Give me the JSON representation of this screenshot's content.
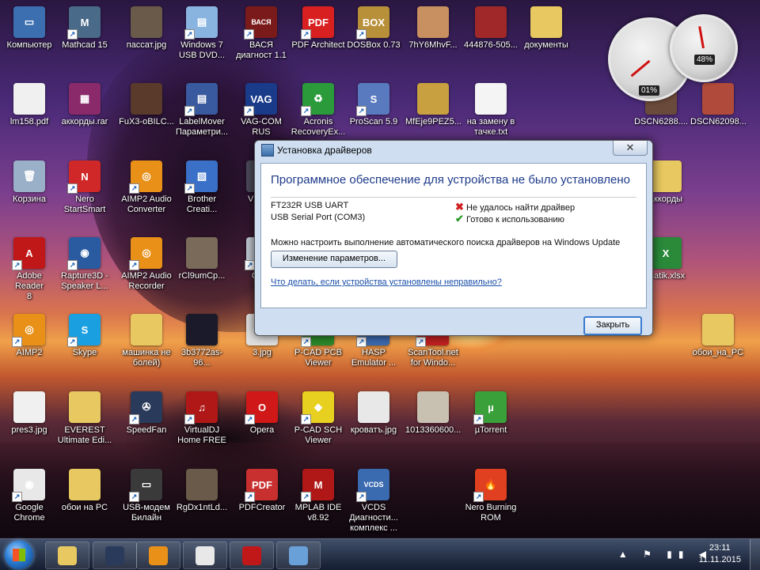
{
  "desktop_icons": [
    {
      "label": "Компьютер",
      "color": "#3b6fb0",
      "sym": "▭",
      "shortcut": false
    },
    {
      "label": "Mathcad 15",
      "color": "#4a6a8a",
      "sym": "M",
      "shortcut": true
    },
    {
      "label": "пассат.jpg",
      "color": "#6a5a4a",
      "sym": "",
      "shortcut": false
    },
    {
      "label": "Windows 7\nUSB DVD...",
      "color": "#8ab4e0",
      "sym": "▤",
      "shortcut": true
    },
    {
      "label": "ВАСЯ\nдиагност 1.1",
      "color": "#7a1a1a",
      "sym": "ВАСЯ",
      "shortcut": true
    },
    {
      "label": "PDF Architect",
      "color": "#d82020",
      "sym": "PDF",
      "shortcut": true
    },
    {
      "label": "DOSBox 0.73",
      "color": "#b8903a",
      "sym": "BOX",
      "shortcut": true
    },
    {
      "label": "7hY6MhvF...",
      "color": "#c89060",
      "sym": "",
      "shortcut": false
    },
    {
      "label": "444876-505...",
      "color": "#a02828",
      "sym": "",
      "shortcut": false
    },
    {
      "label": "документы",
      "color": "#e8c860",
      "sym": "",
      "shortcut": false
    },
    {
      "label": "lm158.pdf",
      "color": "#f0f0f0",
      "sym": "",
      "shortcut": false
    },
    {
      "label": "аккорды.rar",
      "color": "#8a2a6a",
      "sym": "▦",
      "shortcut": false
    },
    {
      "label": "FuX3-oBILC...",
      "color": "#5a3a2a",
      "sym": "",
      "shortcut": false
    },
    {
      "label": "LabelMover\nПараметри...",
      "color": "#3a5aa0",
      "sym": "▤",
      "shortcut": true
    },
    {
      "label": "VAG-COM\nRUS",
      "color": "#1a3a8a",
      "sym": "VAG",
      "shortcut": true
    },
    {
      "label": "Acronis\nRecoveryEx...",
      "color": "#2a9a3a",
      "sym": "♻",
      "shortcut": true
    },
    {
      "label": "ProScan 5.9",
      "color": "#5a7ac0",
      "sym": "S",
      "shortcut": true
    },
    {
      "label": "MfEje9PEZ5...",
      "color": "#c8a040",
      "sym": "",
      "shortcut": false
    },
    {
      "label": "на замену в\nтачке.txt",
      "color": "#f4f4f4",
      "sym": "",
      "shortcut": false
    },
    {
      "label": "DSCN6288....",
      "color": "#6a4a3a",
      "sym": "",
      "shortcut": false
    },
    {
      "label": "DSCN62098...",
      "color": "#b04a3a",
      "sym": "",
      "shortcut": false
    },
    {
      "label": "Корзина",
      "color": "#9ab0c8",
      "sym": "🗑",
      "shortcut": false
    },
    {
      "label": "Nero\nStartSmart",
      "color": "#d02828",
      "sym": "N",
      "shortcut": true
    },
    {
      "label": "AIMP2 Audio\nConverter",
      "color": "#e89018",
      "sym": "◎",
      "shortcut": true
    },
    {
      "label": "Brother\nCreati...",
      "color": "#3a70c8",
      "sym": "▧",
      "shortcut": true
    },
    {
      "label": "VzfsJ...",
      "color": "#4a4a5a",
      "sym": "",
      "shortcut": false
    },
    {
      "label": "аккорды",
      "color": "#e8c860",
      "sym": "",
      "shortcut": false
    },
    {
      "label": "Adobe Reader\n8",
      "color": "#c01818",
      "sym": "A",
      "shortcut": true
    },
    {
      "label": "Rapture3D -\nSpeaker L...",
      "color": "#2a5aa0",
      "sym": "◉",
      "shortcut": true
    },
    {
      "label": "AIMP2 Audio\nRecorder",
      "color": "#e89018",
      "sym": "◎",
      "shortcut": true
    },
    {
      "label": "rCl9umCp...",
      "color": "#7a6a5a",
      "sym": "",
      "shortcut": false
    },
    {
      "label": "Car...\nOl...",
      "color": "#c0c8d0",
      "sym": "",
      "shortcut": true
    },
    {
      "label": "matik.xlsx",
      "color": "#2a8a3a",
      "sym": "X",
      "shortcut": false
    },
    {
      "label": "AIMP2",
      "color": "#e89018",
      "sym": "◎",
      "shortcut": true
    },
    {
      "label": "Skype",
      "color": "#1aa0e0",
      "sym": "S",
      "shortcut": true
    },
    {
      "label": "машинка не\nболей)",
      "color": "#e8c860",
      "sym": "",
      "shortcut": false
    },
    {
      "label": "3b3772as-96...",
      "color": "#1a1a2a",
      "sym": "",
      "shortcut": false
    },
    {
      "label": "3.jpg",
      "color": "#e0e0e0",
      "sym": "",
      "shortcut": false
    },
    {
      "label": "P-CAD PCB\nViewer",
      "color": "#2a8a2a",
      "sym": "◆",
      "shortcut": true
    },
    {
      "label": "HASP\nEmulator ...",
      "color": "#3a6ab0",
      "sym": "EMUL",
      "shortcut": true
    },
    {
      "label": "ScanTool.net\nfor Windo...",
      "color": "#c02020",
      "sym": ".net",
      "shortcut": true
    },
    {
      "label": "обои_на_PC",
      "color": "#e8c860",
      "sym": "",
      "shortcut": false
    },
    {
      "label": "pres3.jpg",
      "color": "#f0f0f0",
      "sym": "",
      "shortcut": false
    },
    {
      "label": "EVEREST\nUltimate Edi...",
      "color": "#e8c860",
      "sym": "",
      "shortcut": false
    },
    {
      "label": "SpeedFan",
      "color": "#2a3a5a",
      "sym": "✇",
      "shortcut": true
    },
    {
      "label": "VirtualDJ\nHome FREE",
      "color": "#b01818",
      "sym": "♫",
      "shortcut": true
    },
    {
      "label": "Opera",
      "color": "#d01818",
      "sym": "O",
      "shortcut": true
    },
    {
      "label": "P-CAD SCH\nViewer",
      "color": "#e8d020",
      "sym": "◆",
      "shortcut": true
    },
    {
      "label": "кроватъ.jpg",
      "color": "#e8e8e8",
      "sym": "",
      "shortcut": false
    },
    {
      "label": "1013360600...",
      "color": "#c8c0b0",
      "sym": "",
      "shortcut": false
    },
    {
      "label": "µTorrent",
      "color": "#3aa03a",
      "sym": "µ",
      "shortcut": true
    },
    {
      "label": "Google\nChrome",
      "color": "#e8e8e8",
      "sym": "◉",
      "shortcut": true
    },
    {
      "label": "обои на PC",
      "color": "#e8c860",
      "sym": "",
      "shortcut": false
    },
    {
      "label": "USB-модем\nБилайн",
      "color": "#3a3a3a",
      "sym": "▭",
      "shortcut": true
    },
    {
      "label": "RgDx1ntLd...",
      "color": "#6a5a4a",
      "sym": "",
      "shortcut": false
    },
    {
      "label": "PDFCreator",
      "color": "#c83030",
      "sym": "PDF",
      "shortcut": true
    },
    {
      "label": "MPLAB IDE\nv8.92",
      "color": "#b01818",
      "sym": "M",
      "shortcut": true
    },
    {
      "label": "VCDS\nДиагности...\nкомплекс ...",
      "color": "#3a6ab0",
      "sym": "VCDS",
      "shortcut": true
    },
    {
      "label": "Nero Burning\nROM",
      "color": "#e04020",
      "sym": "🔥",
      "shortcut": true
    }
  ],
  "gadget": {
    "cpu_percent": "01%",
    "memory_percent": "48%"
  },
  "dialog": {
    "title": "Установка драйверов",
    "close_label": "✕",
    "heading": "Программное обеспечение для устройства не было установлено",
    "devices": [
      {
        "name": "FT232R USB UART",
        "status": "Не удалось найти драйвер",
        "mark": "✖",
        "mark_color": "#d02020"
      },
      {
        "name": "USB Serial Port (COM3)",
        "status": "Готово к использованию",
        "mark": "✔",
        "mark_color": "#2a9a2a"
      }
    ],
    "info_text": "Можно настроить выполнение автоматического поиска драйверов на Windows Update",
    "change_settings_label": "Изменение параметров...",
    "help_link": "Что делать, если устройства установлены неправильно?",
    "close_button_label": "Закрыть"
  },
  "taskbar": {
    "apps": [
      {
        "name": "explorer",
        "color": "#e8c860"
      },
      {
        "name": "speedfan",
        "color": "#2a3a5a"
      },
      {
        "name": "aimp",
        "color": "#e89018"
      },
      {
        "name": "chrome",
        "color": "#e8e8e8"
      },
      {
        "name": "adobe-reader",
        "color": "#c01818"
      },
      {
        "name": "paint",
        "color": "#6aa0d8"
      }
    ],
    "tray_icons": "▲ ⚑ ▮▮ ◀",
    "time": "23:11",
    "date": "11.11.2015"
  }
}
